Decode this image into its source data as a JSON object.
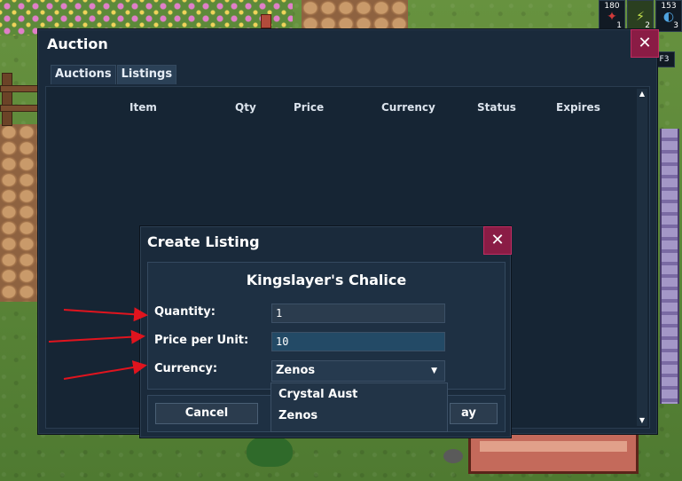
{
  "hud": {
    "slots": [
      {
        "top": "180",
        "bottom": "1",
        "glyph": "✦"
      },
      {
        "top": "",
        "bottom": "2",
        "glyph": "⚡"
      },
      {
        "top": "153",
        "bottom": "3",
        "glyph": "◐"
      }
    ],
    "key_hint": "F3"
  },
  "auction": {
    "title": "Auction",
    "close_glyph": "✕",
    "tabs": [
      {
        "label": "Auctions",
        "active": false
      },
      {
        "label": "Listings",
        "active": true
      }
    ],
    "columns": [
      "Item",
      "Qty",
      "Price",
      "Currency",
      "Status",
      "Expires"
    ],
    "hidden_button_fragment": "ay"
  },
  "dialog": {
    "title": "Create Listing",
    "close_glyph": "✕",
    "item_name": "Kingslayer's Chalice",
    "quantity_label": "Quantity:",
    "quantity_value": "1",
    "price_label": "Price per Unit:",
    "price_value": "10",
    "currency_label": "Currency:",
    "currency_selected": "Zenos",
    "currency_options": [
      "Crystal Aust",
      "Zenos"
    ],
    "cancel_label": "Cancel",
    "confirm_fragment": "ay"
  },
  "colors": {
    "panel": "#1a2a3b",
    "close_button": "#8a1c45",
    "annotation_arrow": "#e0141e"
  }
}
